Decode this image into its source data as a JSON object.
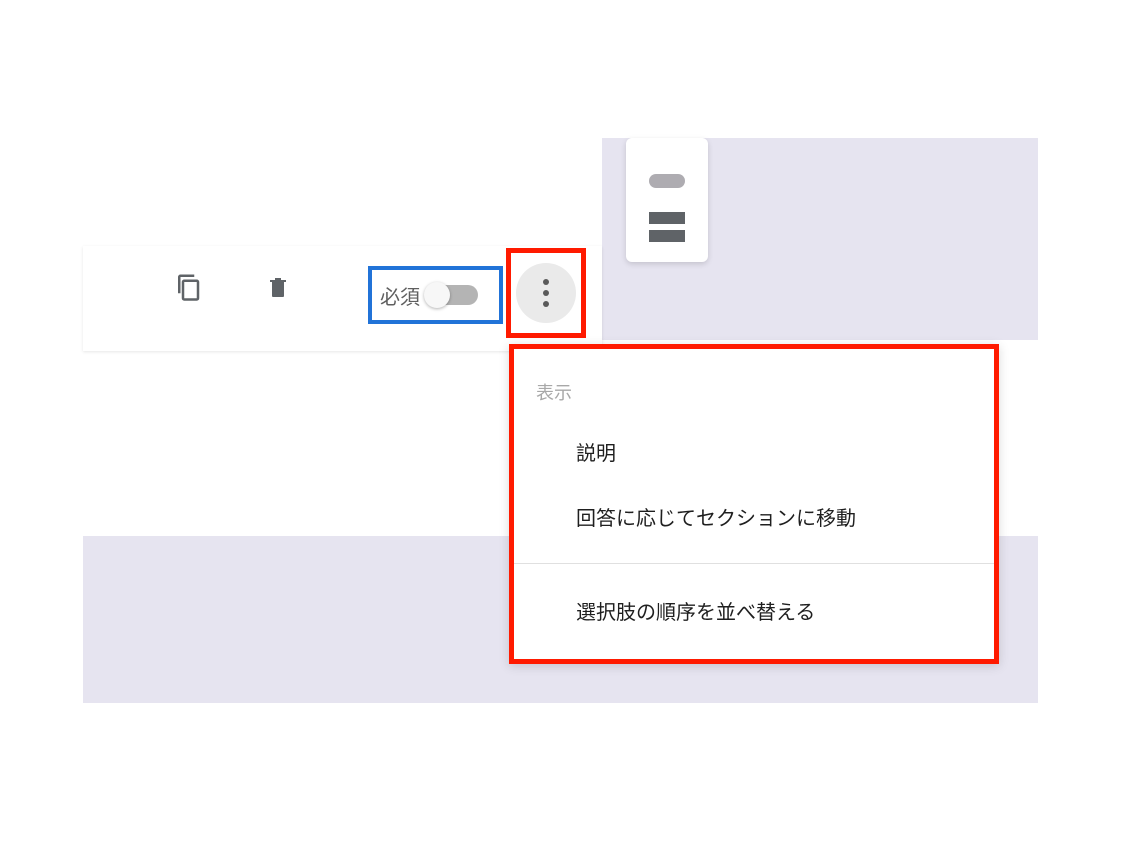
{
  "required": {
    "label": "必須"
  },
  "menu": {
    "header": "表示",
    "items": [
      "説明",
      "回答に応じてセクションに移動"
    ],
    "footer_item": "選択肢の順序を並べ替える"
  },
  "icons": {
    "copy": "copy-icon",
    "trash": "trash-icon",
    "more": "more-vertical-icon",
    "rounded_button": "rounded-button-icon",
    "two_rows": "two-rows-icon"
  },
  "highlight_colors": {
    "blue": "#2173d8",
    "red": "#ff1a00"
  }
}
